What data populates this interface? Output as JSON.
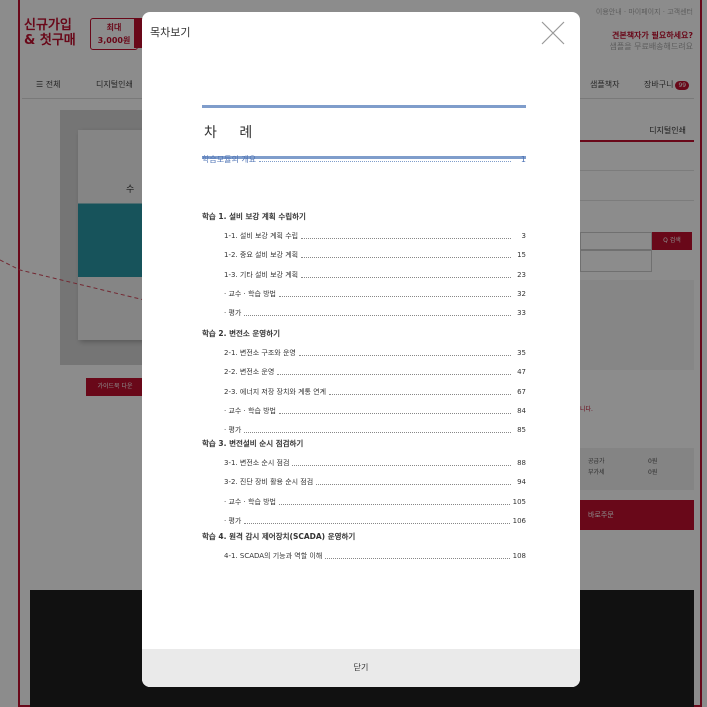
{
  "background": {
    "top_links": "이용안내 · 마이페이지 · 고객센터",
    "signup": [
      "신규가입",
      "& 첫구매"
    ],
    "promo": [
      "최대",
      "3,000원"
    ],
    "ask": {
      "title": "견본책자가 필요하세요?",
      "sub": "샘플을 무료배송해드려요"
    },
    "nav": {
      "all": "☰ 전체",
      "digital_print": "디지털인쇄",
      "sample": "샘플책자",
      "cart": "장바구니",
      "cart_count": "99"
    },
    "book_title": "수",
    "guide_button": "가이드북 다운",
    "right_tab": "디지털인쇄",
    "search_button": "Q 검색",
    "note": "니다.",
    "price": {
      "label1": "공급가",
      "value1": "0원",
      "label2": "부가세",
      "value2": "0원"
    },
    "buy_button": "바로주문"
  },
  "modal": {
    "title": "목차보기",
    "close_label": "닫기",
    "toc": {
      "heading": "차  례",
      "module": {
        "label": "학습모듈의 개요",
        "page": "1"
      },
      "sections": [
        {
          "title": "학습 1. 설비 보강 계획 수립하기",
          "items": [
            {
              "label": "1-1. 설비 보강 계획 수립",
              "page": "3"
            },
            {
              "label": "1-2. 중요 설비 보강 계획",
              "page": "15"
            },
            {
              "label": "1-3. 기타 설비 보강 계획",
              "page": "23"
            },
            {
              "label": "· 교수 · 학습 방법",
              "page": "32"
            },
            {
              "label": "· 평가",
              "page": "33"
            }
          ]
        },
        {
          "title": "학습 2. 변전소 운영하기",
          "items": [
            {
              "label": "2-1. 변전소 구조와 운영",
              "page": "35"
            },
            {
              "label": "2-2. 변전소 운영",
              "page": "47"
            },
            {
              "label": "2-3. 에너지 저장 장치와 계통 연계",
              "page": "67"
            },
            {
              "label": "· 교수 · 학습 방법",
              "page": "84"
            },
            {
              "label": "· 평가",
              "page": "85"
            }
          ]
        },
        {
          "title": "학습 3. 변전설비 순시 점검하기",
          "items": [
            {
              "label": "3-1. 변전소 순시 점검",
              "page": "88"
            },
            {
              "label": "3-2. 진단 장비 활용 순시 점검",
              "page": "94"
            },
            {
              "label": "· 교수 · 학습 방법",
              "page": "105"
            },
            {
              "label": "· 평가",
              "page": "106"
            }
          ]
        },
        {
          "title": "학습 4. 원격 감시 제어장치(SCADA) 운영하기",
          "items": [
            {
              "label": "4-1. SCADA의 기능과 역할 이해",
              "page": "108"
            }
          ]
        }
      ]
    }
  }
}
